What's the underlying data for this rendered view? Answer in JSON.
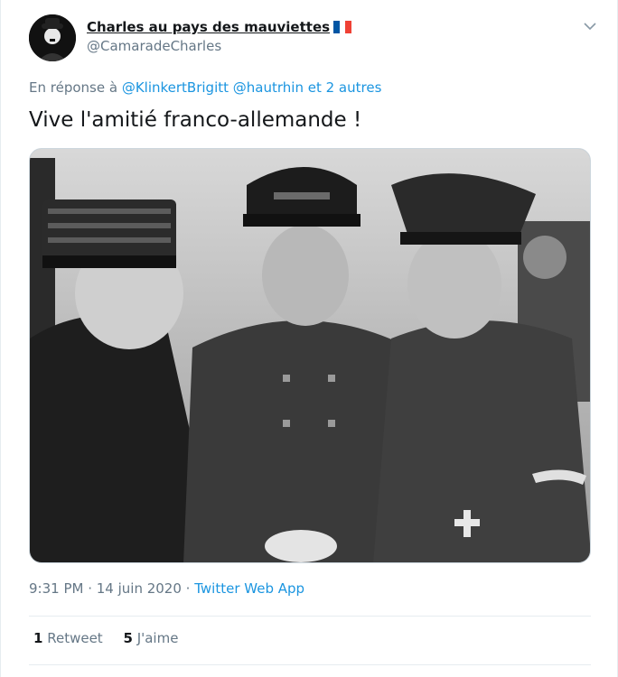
{
  "tweet": {
    "author": {
      "display_name": "Charles au pays des mauviettes",
      "flag_icon": "france-flag-icon",
      "handle": "@CamaradeCharles"
    },
    "reply_to": {
      "prefix": "En réponse à",
      "users": [
        "@KlinkertBrigitt",
        "@hautrhin"
      ],
      "others": "et 2 autres"
    },
    "text": "Vive l'amitié franco-allemande !",
    "media": {
      "description_icon": "photo"
    },
    "timestamp": "9:31 PM · 14 juin 2020 ·",
    "source": "Twitter Web App",
    "stats": {
      "retweets_count": "1",
      "retweets_label": "Retweet",
      "likes_count": "5",
      "likes_label": "J'aime"
    }
  },
  "colors": {
    "link": "#1b95e0",
    "secondary_text": "#657786",
    "primary_text": "#14171a",
    "border": "#e6ecf0"
  }
}
